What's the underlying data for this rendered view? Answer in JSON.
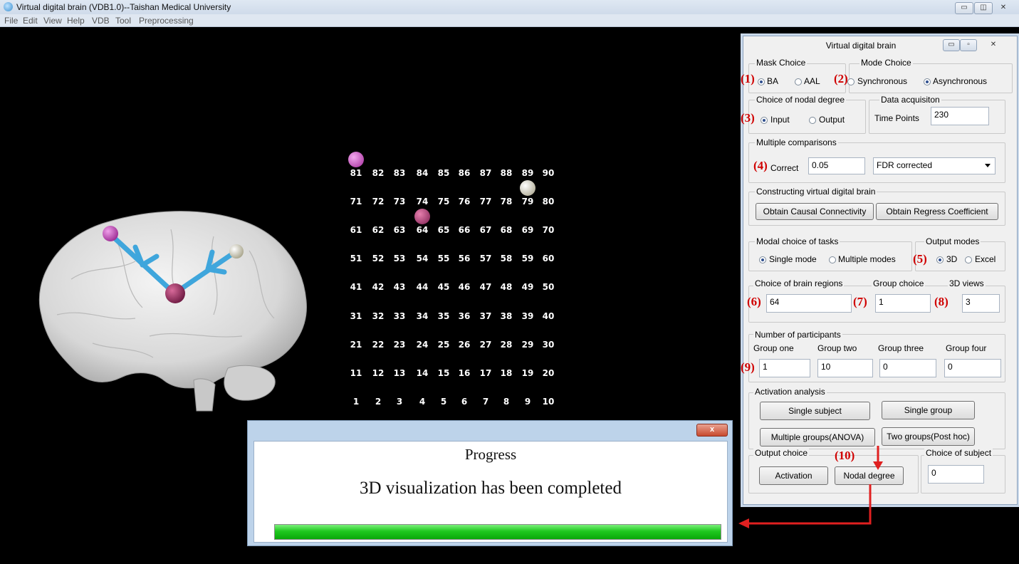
{
  "window": {
    "title": "Virtual digital brain (VDB1.0)--Taishan Medical University",
    "controls": [
      "minimize",
      "maximize",
      "close"
    ]
  },
  "menu": [
    "File",
    "Edit",
    "View",
    "Help",
    "VDB",
    "Tool",
    "Preprocessing"
  ],
  "grid": {
    "rows": [
      [
        "81",
        "82",
        "83",
        "84",
        "85",
        "86",
        "87",
        "88",
        "89",
        "90"
      ],
      [
        "71",
        "72",
        "73",
        "74",
        "75",
        "76",
        "77",
        "78",
        "79",
        "80"
      ],
      [
        "61",
        "62",
        "63",
        "64",
        "65",
        "66",
        "67",
        "68",
        "69",
        "70"
      ],
      [
        "51",
        "52",
        "53",
        "54",
        "55",
        "56",
        "57",
        "58",
        "59",
        "60"
      ],
      [
        "41",
        "42",
        "43",
        "44",
        "45",
        "46",
        "47",
        "48",
        "49",
        "50"
      ],
      [
        "31",
        "32",
        "33",
        "34",
        "35",
        "36",
        "37",
        "38",
        "39",
        "40"
      ],
      [
        "21",
        "22",
        "23",
        "24",
        "25",
        "26",
        "27",
        "28",
        "29",
        "30"
      ],
      [
        "11",
        "12",
        "13",
        "14",
        "15",
        "16",
        "17",
        "18",
        "19",
        "20"
      ],
      [
        "1",
        "2",
        "3",
        "4",
        "5",
        "6",
        "7",
        "8",
        "9",
        "10"
      ]
    ],
    "highlighted_regions": [
      {
        "region": "81",
        "color": "#c64fc0"
      },
      {
        "region": "79",
        "color": "#d8d4b8"
      },
      {
        "region": "64",
        "color": "#b03a7a"
      }
    ]
  },
  "panel": {
    "title": "Virtual  digital  brain",
    "mask_choice": {
      "label": "Mask Choice",
      "options": [
        "BA",
        "AAL"
      ],
      "selected": "BA"
    },
    "mode_choice": {
      "label": "Mode Choice",
      "options": [
        "Synchronous",
        "Asynchronous"
      ],
      "selected": "Asynchronous"
    },
    "nodal_degree": {
      "label": "Choice of nodal degree",
      "options": [
        "Input",
        "Output"
      ],
      "selected": "Input"
    },
    "data_acquisition": {
      "label": "Data acquisiton",
      "field_label": "Time Points",
      "value": "230"
    },
    "multiple_comparisons": {
      "label": "Multiple comparisons",
      "correct_label": "Correct",
      "value": "0.05",
      "method": "FDR corrected"
    },
    "constructing": {
      "label": "Constructing virtual digital brain",
      "btn_causal": "Obtain  Causal Connectivity",
      "btn_regress": "Obtain Regress Coefficient"
    },
    "modal_tasks": {
      "label": "Modal choice of tasks",
      "options": [
        "Single mode",
        "Multiple modes"
      ],
      "selected": "Single mode"
    },
    "output_modes": {
      "label": "Output modes",
      "options": [
        "3D",
        "Excel"
      ],
      "selected": "3D"
    },
    "brain_regions": {
      "label": "Choice of brain regions",
      "value": "64"
    },
    "group_choice": {
      "label": "Group choice",
      "value": "1"
    },
    "views_3d": {
      "label": "3D views",
      "value": "3"
    },
    "participants": {
      "label": "Number of participants",
      "groups": [
        {
          "label": "Group one",
          "value": "1"
        },
        {
          "label": "Group two",
          "value": "10"
        },
        {
          "label": "Group three",
          "value": "0"
        },
        {
          "label": "Group four",
          "value": "0"
        }
      ]
    },
    "activation": {
      "label": "Activation analysis",
      "btn_single_subject": "Single subject",
      "btn_single_group": "Single group",
      "btn_anova": "Multiple groups(ANOVA)",
      "btn_posthoc": "Two groups(Post hoc)"
    },
    "output_choice": {
      "label": "Output choice",
      "btn_activation": "Activation",
      "btn_nodal": "Nodal degree"
    },
    "choice_subject": {
      "label": "Choice of subject",
      "value": "0"
    }
  },
  "annotations": [
    "(1)",
    "(2)",
    "(3)",
    "(4)",
    "(5)",
    "(6)",
    "(7)",
    "(8)",
    "(9)",
    "(10)"
  ],
  "progress": {
    "title": "Progress",
    "message": "3D visualization has been completed",
    "fraction": 1.0,
    "close_glyph": "x"
  },
  "colors": {
    "annotation_red": "#d00000",
    "progress_green": "#1fc81f",
    "tract_blue": "#3fa6dc",
    "background": "#000000"
  }
}
